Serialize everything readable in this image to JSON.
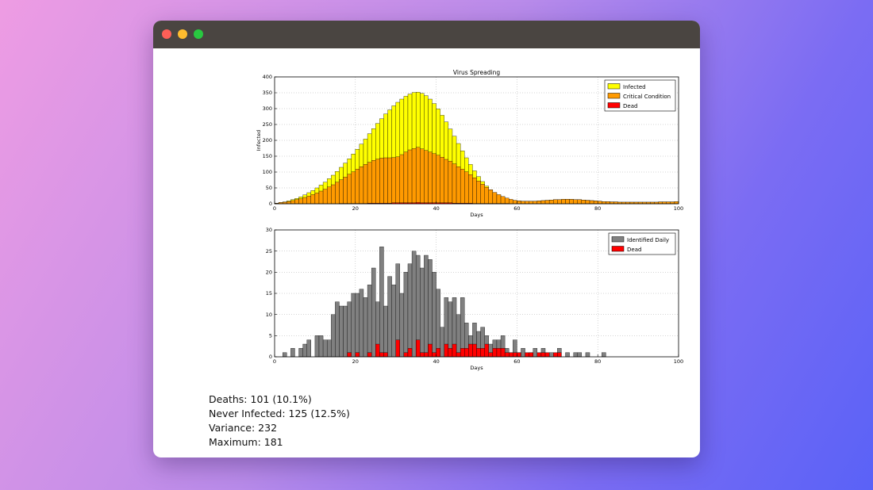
{
  "window": {
    "controls": [
      "close",
      "minimize",
      "zoom"
    ]
  },
  "stats": [
    "Deaths: 101 (10.1%)",
    "Never Infected: 125 (12.5%)",
    "Variance: 232",
    "Maximum: 181"
  ],
  "chart_data": [
    {
      "type": "bar",
      "stacked": false,
      "title": "Virus Spreading",
      "xlabel": "Days",
      "ylabel": "Infected",
      "xlim": [
        0,
        100
      ],
      "ylim": [
        0,
        400
      ],
      "xticks": [
        "0",
        "20",
        "40",
        "60",
        "80",
        "100"
      ],
      "yticks": [
        "0",
        "50",
        "100",
        "150",
        "200",
        "250",
        "300",
        "350",
        "400"
      ],
      "grid": true,
      "legend_position": "top-right",
      "series": [
        {
          "name": "Infected",
          "color": "#ffff00",
          "values": [
            2,
            4,
            6,
            9,
            13,
            17,
            22,
            28,
            35,
            42,
            50,
            59,
            68,
            79,
            90,
            102,
            115,
            128,
            142,
            157,
            172,
            188,
            204,
            221,
            237,
            253,
            268,
            283,
            296,
            309,
            320,
            330,
            339,
            346,
            351,
            352,
            348,
            341,
            330,
            316,
            299,
            279,
            258,
            236,
            213,
            190,
            167,
            145,
            124,
            104,
            86,
            70,
            56,
            44,
            34,
            26,
            20,
            15,
            12,
            10,
            9,
            8,
            8,
            8,
            8,
            9,
            10,
            11,
            12,
            13,
            13,
            14,
            14,
            14,
            13,
            13,
            12,
            11,
            10,
            9,
            8,
            7,
            7,
            6,
            6,
            5,
            5,
            5,
            5,
            5,
            5,
            5,
            5,
            5,
            5,
            6,
            6,
            6,
            6,
            7
          ]
        },
        {
          "name": "Critical Condition",
          "color": "#ff9a00",
          "values": [
            2,
            4,
            5,
            7,
            10,
            13,
            16,
            20,
            24,
            29,
            34,
            40,
            46,
            53,
            60,
            68,
            76,
            84,
            93,
            101,
            109,
            117,
            124,
            131,
            137,
            141,
            144,
            145,
            145,
            146,
            148,
            155,
            163,
            170,
            174,
            178,
            173,
            168,
            163,
            158,
            153,
            147,
            140,
            134,
            126,
            117,
            109,
            101,
            92,
            82,
            72,
            62,
            52,
            44,
            36,
            29,
            23,
            18,
            14,
            11,
            9,
            8,
            8,
            8,
            8,
            9,
            10,
            11,
            12,
            13,
            13,
            14,
            14,
            14,
            13,
            13,
            12,
            11,
            10,
            9,
            8,
            7,
            7,
            6,
            6,
            5,
            5,
            5,
            5,
            5,
            5,
            5,
            5,
            5,
            5,
            6,
            6,
            6,
            6,
            7
          ]
        },
        {
          "name": "Dead",
          "color": "#ff0000",
          "values": [
            0,
            0,
            0,
            0,
            0,
            0,
            0,
            0,
            0,
            0,
            0,
            0,
            0,
            0,
            0,
            0,
            1,
            1,
            1,
            1,
            1,
            1,
            1,
            2,
            2,
            2,
            2,
            2,
            2,
            3,
            3,
            3,
            3,
            3,
            3,
            4,
            3,
            3,
            3,
            3,
            3,
            3,
            3,
            3,
            2,
            2,
            2,
            2,
            2,
            1,
            1,
            1,
            1,
            1,
            1,
            1,
            1,
            1,
            0,
            0,
            0,
            0,
            0,
            0,
            0,
            0,
            0,
            0,
            0,
            0,
            0,
            0,
            0,
            0,
            0,
            0,
            0,
            0,
            0,
            0,
            0,
            0,
            0,
            0,
            0,
            0,
            0,
            0,
            0,
            0,
            0,
            0,
            0,
            0,
            0,
            0,
            0,
            0,
            0,
            0
          ]
        }
      ]
    },
    {
      "type": "bar",
      "stacked": false,
      "title": "",
      "xlabel": "Days",
      "ylabel": "",
      "xlim": [
        0,
        100
      ],
      "ylim": [
        0,
        30
      ],
      "xticks": [
        "0",
        "20",
        "40",
        "60",
        "80",
        "100"
      ],
      "yticks": [
        "0",
        "5",
        "10",
        "15",
        "20",
        "25",
        "30"
      ],
      "grid": true,
      "legend_position": "top-right",
      "series": [
        {
          "name": "Identified Daily",
          "color": "#808080",
          "values": [
            0,
            0,
            1,
            0,
            2,
            0,
            2,
            3,
            4,
            0,
            5,
            5,
            4,
            4,
            10,
            13,
            12,
            12,
            13,
            15,
            15,
            16,
            14,
            17,
            21,
            13,
            26,
            12,
            19,
            17,
            22,
            15,
            20,
            22,
            25,
            24,
            21,
            24,
            23,
            20,
            16,
            7,
            14,
            13,
            14,
            10,
            14,
            8,
            5,
            8,
            6,
            7,
            5,
            3,
            4,
            4,
            5,
            2,
            1,
            4,
            1,
            2,
            0,
            1,
            2,
            0,
            2,
            0,
            1,
            0,
            2,
            0,
            1,
            0,
            1,
            1,
            0,
            1,
            0,
            0,
            0,
            1,
            0,
            0,
            0,
            0,
            0,
            0,
            0,
            0,
            0,
            0,
            0,
            0,
            0,
            0,
            0,
            0,
            0,
            0
          ]
        },
        {
          "name": "Dead",
          "color": "#ff0000",
          "values": [
            0,
            0,
            0,
            0,
            0,
            0,
            0,
            0,
            0,
            0,
            0,
            0,
            0,
            0,
            0,
            0,
            0,
            0,
            1,
            0,
            1,
            0,
            0,
            1,
            0,
            3,
            1,
            1,
            0,
            0,
            4,
            0,
            1,
            2,
            0,
            4,
            1,
            1,
            3,
            1,
            2,
            0,
            3,
            2,
            3,
            1,
            2,
            2,
            3,
            3,
            2,
            2,
            3,
            1,
            2,
            2,
            2,
            1,
            1,
            1,
            1,
            0,
            1,
            1,
            0,
            1,
            1,
            1,
            0,
            1,
            1,
            0,
            0,
            0,
            0,
            0,
            0,
            0,
            0,
            0,
            0,
            0,
            0,
            0,
            0,
            0,
            0,
            0,
            0,
            0,
            0,
            0,
            0,
            0,
            0,
            0,
            0,
            0,
            0,
            0
          ]
        }
      ]
    }
  ]
}
